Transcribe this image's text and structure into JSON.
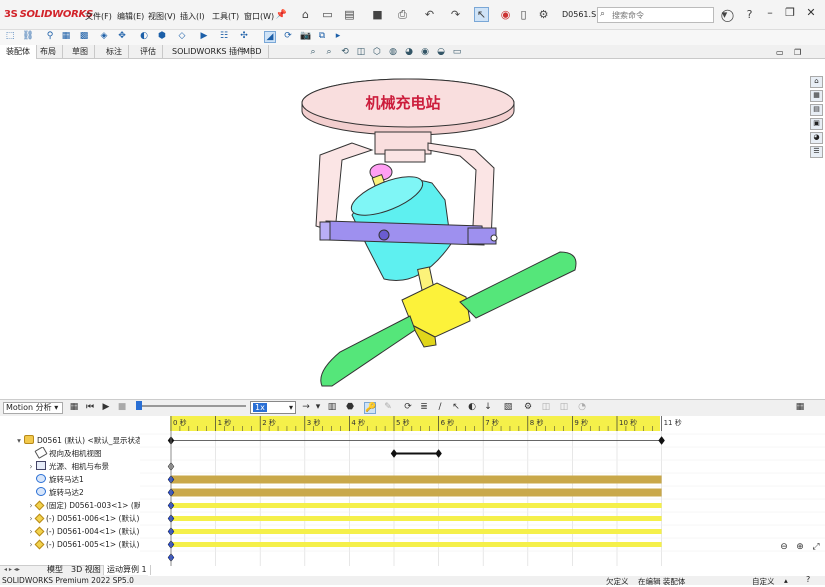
{
  "app": {
    "logo_text": "SOLIDWORKS",
    "logo_prefix": "3S"
  },
  "menu": [
    "文件(F)",
    "编辑(E)",
    "视图(V)",
    "插入(I)",
    "工具(T)",
    "窗口(W)"
  ],
  "document_name": "D0561.S...",
  "search": {
    "placeholder": "搜索命令"
  },
  "command_tabs": [
    "装配体",
    "布局",
    "草图",
    "标注",
    "评估",
    "SOLIDWORKS 插件",
    "MBD"
  ],
  "model_label": "机械充电站",
  "motion": {
    "study_type": "Motion 分析",
    "speed": "1x",
    "time_ticks": [
      "0 秒",
      "1 秒",
      "2 秒",
      "3 秒",
      "4 秒",
      "5 秒",
      "6 秒",
      "7 秒",
      "8 秒",
      "9 秒",
      "10 秒",
      "11 秒"
    ]
  },
  "tree": [
    {
      "label": "D0561 (默认) <默认_显示状态",
      "indent": 0,
      "expander": "▾",
      "icon": "assembly-icon"
    },
    {
      "label": "视向及相机视图",
      "indent": 1,
      "expander": "",
      "icon": "camera-icon"
    },
    {
      "label": "光源、相机与布景",
      "indent": 1,
      "expander": "›",
      "icon": "lights-icon"
    },
    {
      "label": "旋转马达1",
      "indent": 1,
      "expander": "",
      "icon": "motor-icon"
    },
    {
      "label": "旋转马达2",
      "indent": 1,
      "expander": "",
      "icon": "motor-icon"
    },
    {
      "label": "(固定) D0561-003<1> (默",
      "indent": 1,
      "expander": "›",
      "icon": "part-icon"
    },
    {
      "label": "(-) D0561-006<1> (默认)",
      "indent": 1,
      "expander": "›",
      "icon": "part-icon"
    },
    {
      "label": "(-) D0561-004<1> (默认)",
      "indent": 1,
      "expander": "›",
      "icon": "part-icon"
    },
    {
      "label": "(-) D0561-005<1> (默认)",
      "indent": 1,
      "expander": "›",
      "icon": "part-icon"
    }
  ],
  "bottom_tabs": [
    "模型",
    "3D 视图",
    "运动算例 1"
  ],
  "status": {
    "version": "SOLIDWORKS Premium 2022 SP5.0",
    "definition": "欠定义",
    "editing": "在编辑 装配体",
    "units": "自定义"
  },
  "colors": {
    "accent": "#2a6fd4",
    "timeline_ruler": "#f5f04a",
    "motor_bar": "#c9a84a",
    "part_bar": "#f5f04a"
  }
}
